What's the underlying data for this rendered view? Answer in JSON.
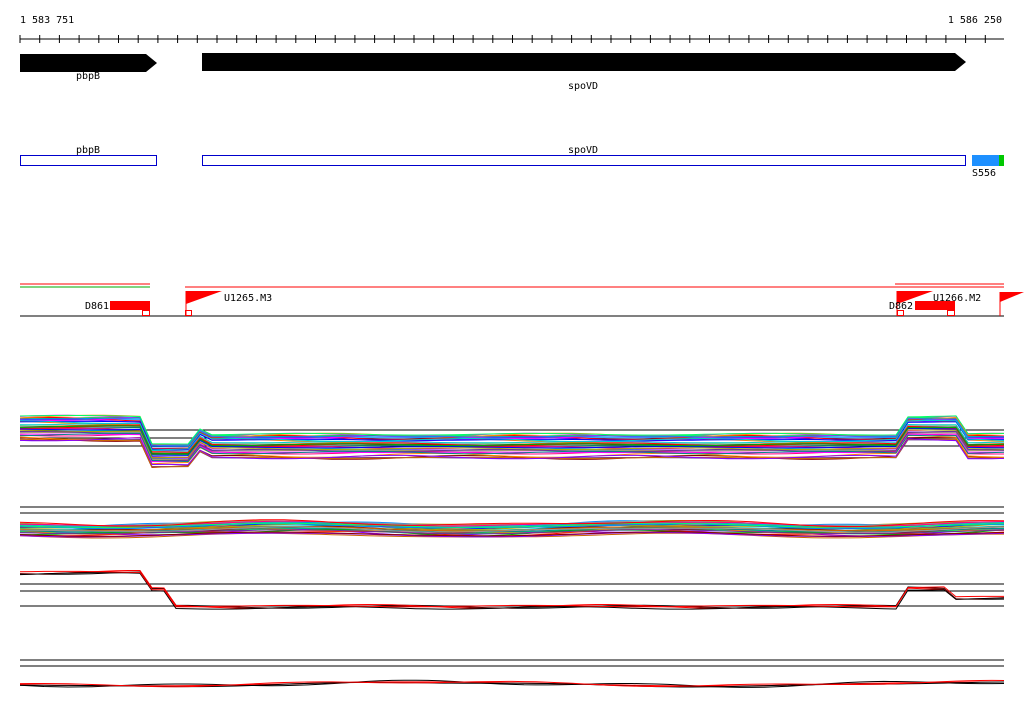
{
  "ruler": {
    "start_label": "1 583 751",
    "end_label": "1 586 250"
  },
  "genes": {
    "pbpB": {
      "label": "pbpB",
      "direction": "forward"
    },
    "spoVD": {
      "label": "spoVD",
      "direction": "forward"
    }
  },
  "annotation_track": {
    "pbpB_label": "pbpB",
    "spoVD_label": "spoVD",
    "s556_label": "S556",
    "s556_colors": [
      "#1e90ff",
      "#00c800"
    ]
  },
  "transcript_track": {
    "d861_label": "D861",
    "u1265_label": "U1265.M3",
    "d862_label": "D862",
    "u1266_label": "U1266.M2",
    "feature_color": "#ff0000"
  },
  "profile_colors": [
    "#ff0000",
    "#00aa00",
    "#0000ff",
    "#ff00ff",
    "#00cccc",
    "#ff8800",
    "#8800ff",
    "#008888",
    "#aaaa00",
    "#ff0088",
    "#0088ff",
    "#880000",
    "#00ff66",
    "#663399",
    "#cc6600",
    "#999999"
  ]
}
